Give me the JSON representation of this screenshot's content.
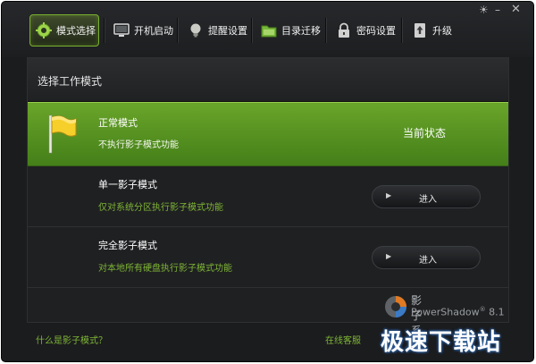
{
  "window": {
    "controls": {
      "menu": "☀",
      "minimize": "–",
      "close": "✕"
    }
  },
  "tabs": [
    {
      "label": "模式选择",
      "icon": "gear-icon",
      "active": true
    },
    {
      "label": "开机启动",
      "icon": "monitor-icon",
      "active": false
    },
    {
      "label": "提醒设置",
      "icon": "lightbulb-icon",
      "active": false
    },
    {
      "label": "目录迁移",
      "icon": "folder-icon",
      "active": false
    },
    {
      "label": "密码设置",
      "icon": "lock-icon",
      "active": false
    },
    {
      "label": "升级",
      "icon": "upgrade-icon",
      "active": false
    }
  ],
  "panel": {
    "title": "选择工作模式",
    "modes": [
      {
        "title": "正常模式",
        "desc": "不执行影子模式功能",
        "status": "当前状态",
        "icon": "flag-icon"
      },
      {
        "title": "单一影子模式",
        "desc": "仅对系统分区执行影子模式功能",
        "button": "进入"
      },
      {
        "title": "完全影子模式",
        "desc": "对本地所有硬盘执行影子模式功能",
        "button": "进入"
      }
    ]
  },
  "brand": {
    "name_cn": "影子系统",
    "name_en": "PowerShadow",
    "reg": "®",
    "version": "8.1"
  },
  "footer": {
    "help_link": "什么是影子模式？",
    "service_link": "在线客服"
  },
  "watermark": "极速下载站",
  "colors": {
    "accent_green": "#5c9a24",
    "link_green": "#7fb636",
    "background": "#1b1c1e"
  }
}
